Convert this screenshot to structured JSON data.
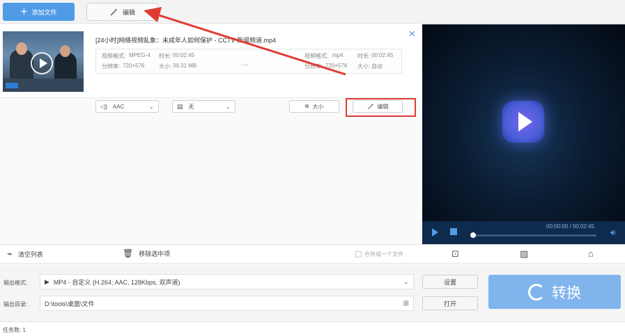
{
  "toolbar": {
    "add_file_label": "添加文件",
    "edit_label": "编辑"
  },
  "file": {
    "name": "[24小时]网络视频乱象：未成年人如何保护  - CCTV 新闻频道.mp4",
    "source": {
      "format_label": "视频格式:",
      "format": "MPEG-4",
      "duration_label": "时长:",
      "duration": "00:02:45",
      "resolution_label": "分辨率:",
      "resolution": "720×576",
      "size_label": "大小:",
      "size": "39.31 MB"
    },
    "target": {
      "format_label": "视频格式:",
      "format": "mp4",
      "duration_label": "时长:",
      "duration": "00:02:45",
      "resolution_label": "分辨率:",
      "resolution": "720×576",
      "size_label": "大小:",
      "size": "自动"
    },
    "audio_select": "AAC",
    "subtitle_select": "无",
    "size_button": "大小",
    "edit_button": "编辑"
  },
  "player": {
    "time": "00:00:00 / 00:02:45",
    "progress": 0
  },
  "list_actions": {
    "clear_label": "清空列表",
    "remove_label": "移除选中项",
    "merge_label": "合并成一个文件"
  },
  "output": {
    "format_label": "输出格式:",
    "format_value": "MP4 - 自定义 (H.264; AAC, 128Kbps, 双声道)",
    "dir_label": "输出目录:",
    "dir_value": "D:\\tools\\桌面\\文件",
    "settings_button": "设置",
    "open_button": "打开",
    "convert_button": "转换"
  },
  "status": {
    "task_count": "任务数: 1"
  },
  "colors": {
    "accent": "#4f9be6",
    "convert": "#7fb5ec",
    "annotation": "#e03b32"
  }
}
